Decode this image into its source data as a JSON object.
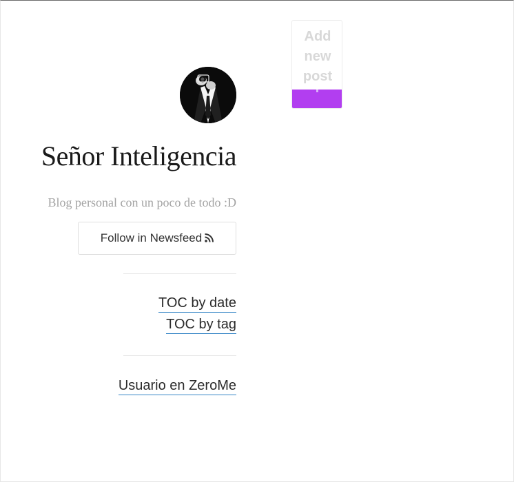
{
  "blog": {
    "title": "Señor Inteligencia",
    "description": "Blog personal con un poco de todo :D"
  },
  "actions": {
    "follow_label": "Follow in Newsfeed",
    "add_post_label": "Add new post"
  },
  "nav": {
    "toc_by_date": "TOC by date",
    "toc_by_tag": "TOC by tag",
    "zerome_user": "Usuario en ZeroMe"
  },
  "icons": {
    "avatar": "avatar-photographer-in-suit",
    "follow": "rss-icon"
  },
  "colors": {
    "accent": "#b23ef0",
    "link_underline": "#2f82c4",
    "muted_text": "#a3a3a3"
  }
}
